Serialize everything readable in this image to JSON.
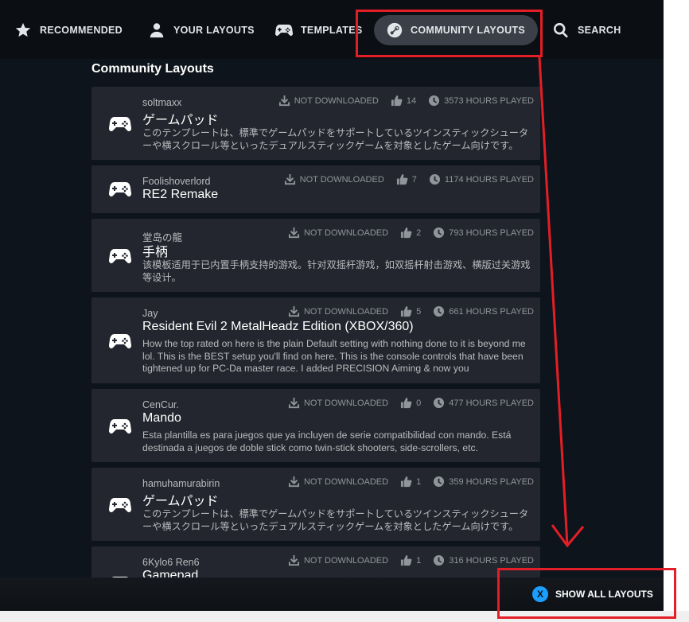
{
  "nav": {
    "recommended": "RECOMMENDED",
    "your_layouts": "YOUR LAYOUTS",
    "templates": "TEMPLATES",
    "community_layouts": "COMMUNITY LAYOUTS",
    "search": "SEARCH"
  },
  "section_title": "Community Layouts",
  "layouts": [
    {
      "author": "soltmaxx",
      "title": "ゲームパッド",
      "description": "このテンプレートは、標準でゲームパッドをサポートしているツインスティックシューターや横スクロール等といったデュアルスティックゲームを対象としたゲーム向けです。",
      "status": "NOT DOWNLOADED",
      "likes": "14",
      "hours": "3573 HOURS PLAYED"
    },
    {
      "author": "Foolishoverlord",
      "title": "RE2 Remake",
      "description": "",
      "status": "NOT DOWNLOADED",
      "likes": "7",
      "hours": "1174 HOURS PLAYED"
    },
    {
      "author": "堂岛の龍",
      "title": "手柄",
      "description": "该模板适用于已内置手柄支持的游戏。针对双摇杆游戏，如双摇杆射击游戏、横版过关游戏等设计。",
      "status": "NOT DOWNLOADED",
      "likes": "2",
      "hours": "793 HOURS PLAYED"
    },
    {
      "author": "Jay",
      "title": "Resident Evil 2 MetalHeadz Edition (XBOX/360)",
      "description": "How the top rated on here is the plain Default setting with nothing done to it is beyond me lol. This is the BEST setup you'll find on here. This is the console controls that have been tightened up for PC-Da master race. I added PRECISION Aiming & now you",
      "status": "NOT DOWNLOADED",
      "likes": "5",
      "hours": "661 HOURS PLAYED"
    },
    {
      "author": "CenCur.",
      "title": "Mando",
      "description": "Esta plantilla es para juegos que ya incluyen de serie compatibilidad con mando. Está destinada a juegos de doble stick como twin-stick shooters, side-scrollers, etc.",
      "status": "NOT DOWNLOADED",
      "likes": "0",
      "hours": "477 HOURS PLAYED"
    },
    {
      "author": "hamuhamurabirin",
      "title": "ゲームパッド",
      "description": "このテンプレートは、標準でゲームパッドをサポートしているツインスティックシューターや横スクロール等といったデュアルスティックゲームを対象としたゲーム向けです。",
      "status": "NOT DOWNLOADED",
      "likes": "1",
      "hours": "359 HOURS PLAYED"
    },
    {
      "author": "6Kylo6 Ren6",
      "title": "Gamepad",
      "description": "",
      "status": "NOT DOWNLOADED",
      "likes": "1",
      "hours": "316 HOURS PLAYED"
    }
  ],
  "footer": {
    "button_glyph": "X",
    "show_all_label": "SHOW ALL LAYOUTS"
  },
  "colors": {
    "accent_red": "#e41e26",
    "button_blue": "#1a9fff",
    "card_bg": "#23262e"
  }
}
